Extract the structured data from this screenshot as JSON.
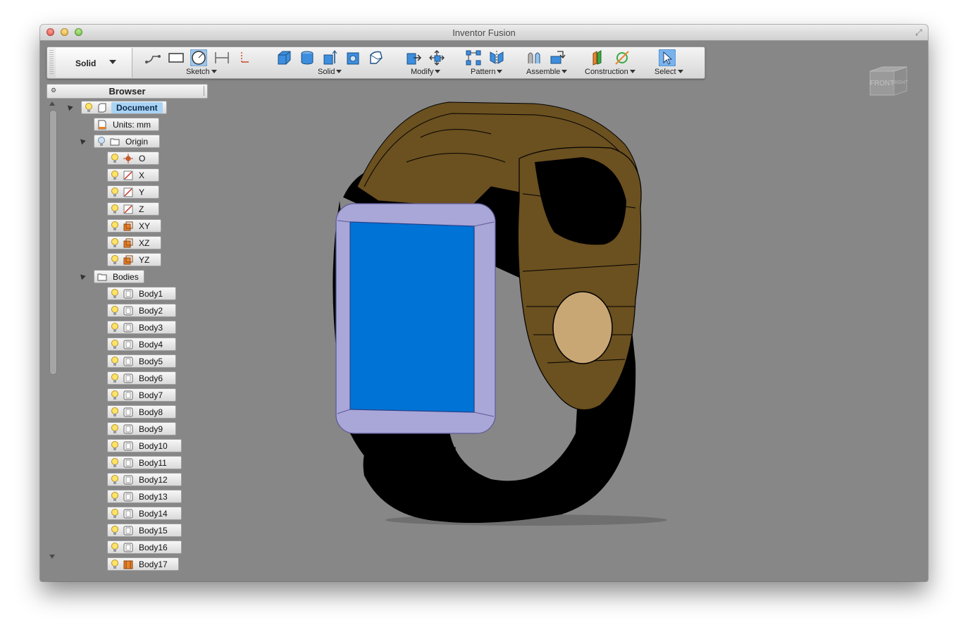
{
  "window": {
    "title": "Inventor Fusion"
  },
  "ribbon": {
    "mode": {
      "label": "Solid"
    },
    "groups": [
      {
        "label": "Sketch"
      },
      {
        "label": "Solid"
      },
      {
        "label": "Modify"
      },
      {
        "label": "Pattern"
      },
      {
        "label": "Assemble"
      },
      {
        "label": "Construction"
      },
      {
        "label": "Select"
      }
    ]
  },
  "viewcube": {
    "front": "FRONT",
    "right": "RIGHT"
  },
  "browser": {
    "title": "Browser",
    "document": {
      "label": "Document"
    },
    "units": {
      "label": "Units: mm"
    },
    "origin": {
      "label": "Origin",
      "items": [
        {
          "label": "O",
          "icon": "point-icon"
        },
        {
          "label": "X",
          "icon": "axis-icon"
        },
        {
          "label": "Y",
          "icon": "axis-icon"
        },
        {
          "label": "Z",
          "icon": "axis-icon"
        },
        {
          "label": "XY",
          "icon": "plane-icon"
        },
        {
          "label": "XZ",
          "icon": "plane-icon"
        },
        {
          "label": "YZ",
          "icon": "plane-icon"
        }
      ]
    },
    "bodies": {
      "label": "Bodies",
      "items": [
        {
          "label": "Body1"
        },
        {
          "label": "Body2"
        },
        {
          "label": "Body3"
        },
        {
          "label": "Body4"
        },
        {
          "label": "Body5"
        },
        {
          "label": "Body6"
        },
        {
          "label": "Body7"
        },
        {
          "label": "Body8"
        },
        {
          "label": "Body9"
        },
        {
          "label": "Body10"
        },
        {
          "label": "Body11"
        },
        {
          "label": "Body12"
        },
        {
          "label": "Body13"
        },
        {
          "label": "Body14"
        },
        {
          "label": "Body15"
        },
        {
          "label": "Body16"
        },
        {
          "label": "Body17"
        }
      ]
    }
  },
  "colors": {
    "viewport_bg": "#878787",
    "strap": "#6b5020",
    "button": "#c9a775",
    "screen": "#0073d6",
    "bezel": "#a9a6d8",
    "selection": "#a9d3f5"
  }
}
